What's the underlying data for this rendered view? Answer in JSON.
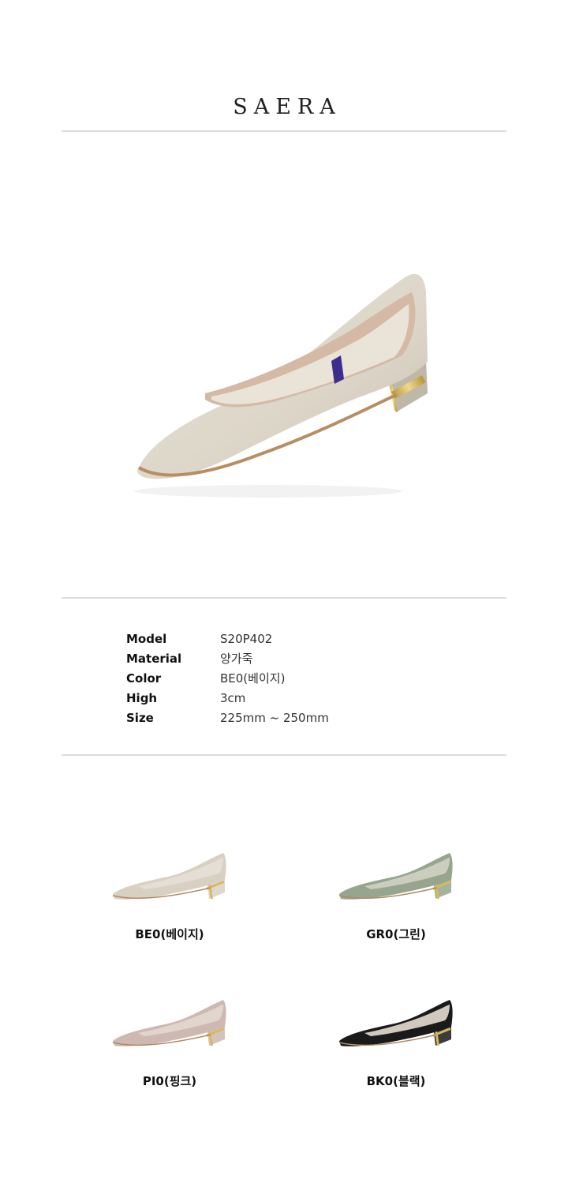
{
  "brand": {
    "name": "SAERA"
  },
  "specs": [
    {
      "key": "Model",
      "value": "S20P402"
    },
    {
      "key": "Material",
      "value": "양가죽"
    },
    {
      "key": "Color",
      "value": "BE0(베이지)"
    },
    {
      "key": "High",
      "value": "3cm"
    },
    {
      "key": "Size",
      "value": "225mm ~ 250mm"
    }
  ],
  "variants": [
    {
      "label": "BE0(베이지)",
      "color": "#d8d0c3"
    },
    {
      "label": "GR0(그린)",
      "color": "#97a58f"
    },
    {
      "label": "PI0(핑크)",
      "color": "#cdb9b1"
    },
    {
      "label": "BK0(블랙)",
      "color": "#1a1a1a"
    }
  ],
  "colors": {
    "hero_leather": "#dfd9cd",
    "lining": "#c9a792",
    "heel_gold": "#d2b15e",
    "divider": "#dcdcdc"
  }
}
